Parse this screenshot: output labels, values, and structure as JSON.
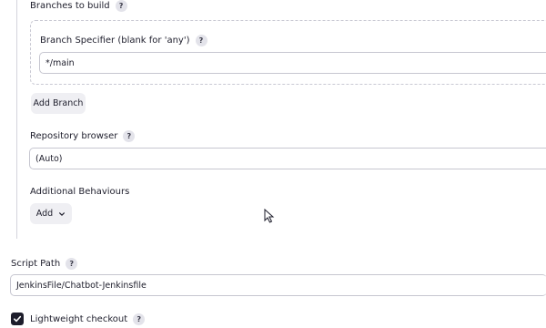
{
  "branches": {
    "title": "Branches to build",
    "help": "?",
    "specifier_label": "Branch Specifier (blank for 'any')",
    "specifier_help": "?",
    "specifier_value": "*/main",
    "add_branch_label": "Add Branch"
  },
  "repository_browser": {
    "label": "Repository browser",
    "help": "?",
    "value": "(Auto)"
  },
  "additional_behaviours": {
    "label": "Additional Behaviours",
    "add_label": "Add"
  },
  "script_path": {
    "label": "Script Path",
    "help": "?",
    "value": "JenkinsFile/Chatbot-Jenkinsfile"
  },
  "lightweight_checkout": {
    "label": "Lightweight checkout",
    "help": "?",
    "checked": true
  },
  "icons": [
    "help-icon",
    "chevron-down-icon",
    "checkmark-icon",
    "mouse-cursor-icon"
  ]
}
